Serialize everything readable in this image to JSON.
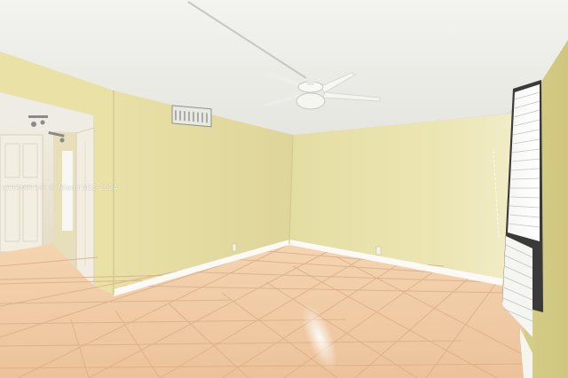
{
  "photo": {
    "watermark": "A1170813® © Miami MLS 2024"
  }
}
